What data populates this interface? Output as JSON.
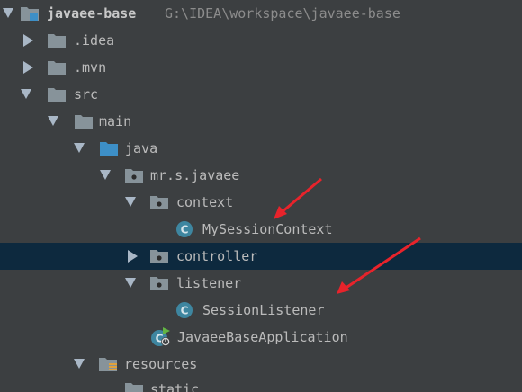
{
  "project": {
    "name": "javaee-base",
    "path": "G:\\IDEA\\workspace\\javaee-base"
  },
  "tree": {
    "idea": ".idea",
    "mvn": ".mvn",
    "src": "src",
    "main": "main",
    "java": "java",
    "package": "mr.s.javaee",
    "context": "context",
    "my_session_context": "MySessionContext",
    "controller": "controller",
    "listener": "listener",
    "session_listener": "SessionListener",
    "app_class": "JavaeeBaseApplication",
    "resources": "resources",
    "static": "static"
  },
  "colors": {
    "background": "#3c3f41",
    "selection": "#0d293e",
    "folder": "#87939a",
    "source_folder": "#3d8fc7",
    "class_icon": "#3e86a0",
    "annotation_arrow": "#e8232b"
  }
}
